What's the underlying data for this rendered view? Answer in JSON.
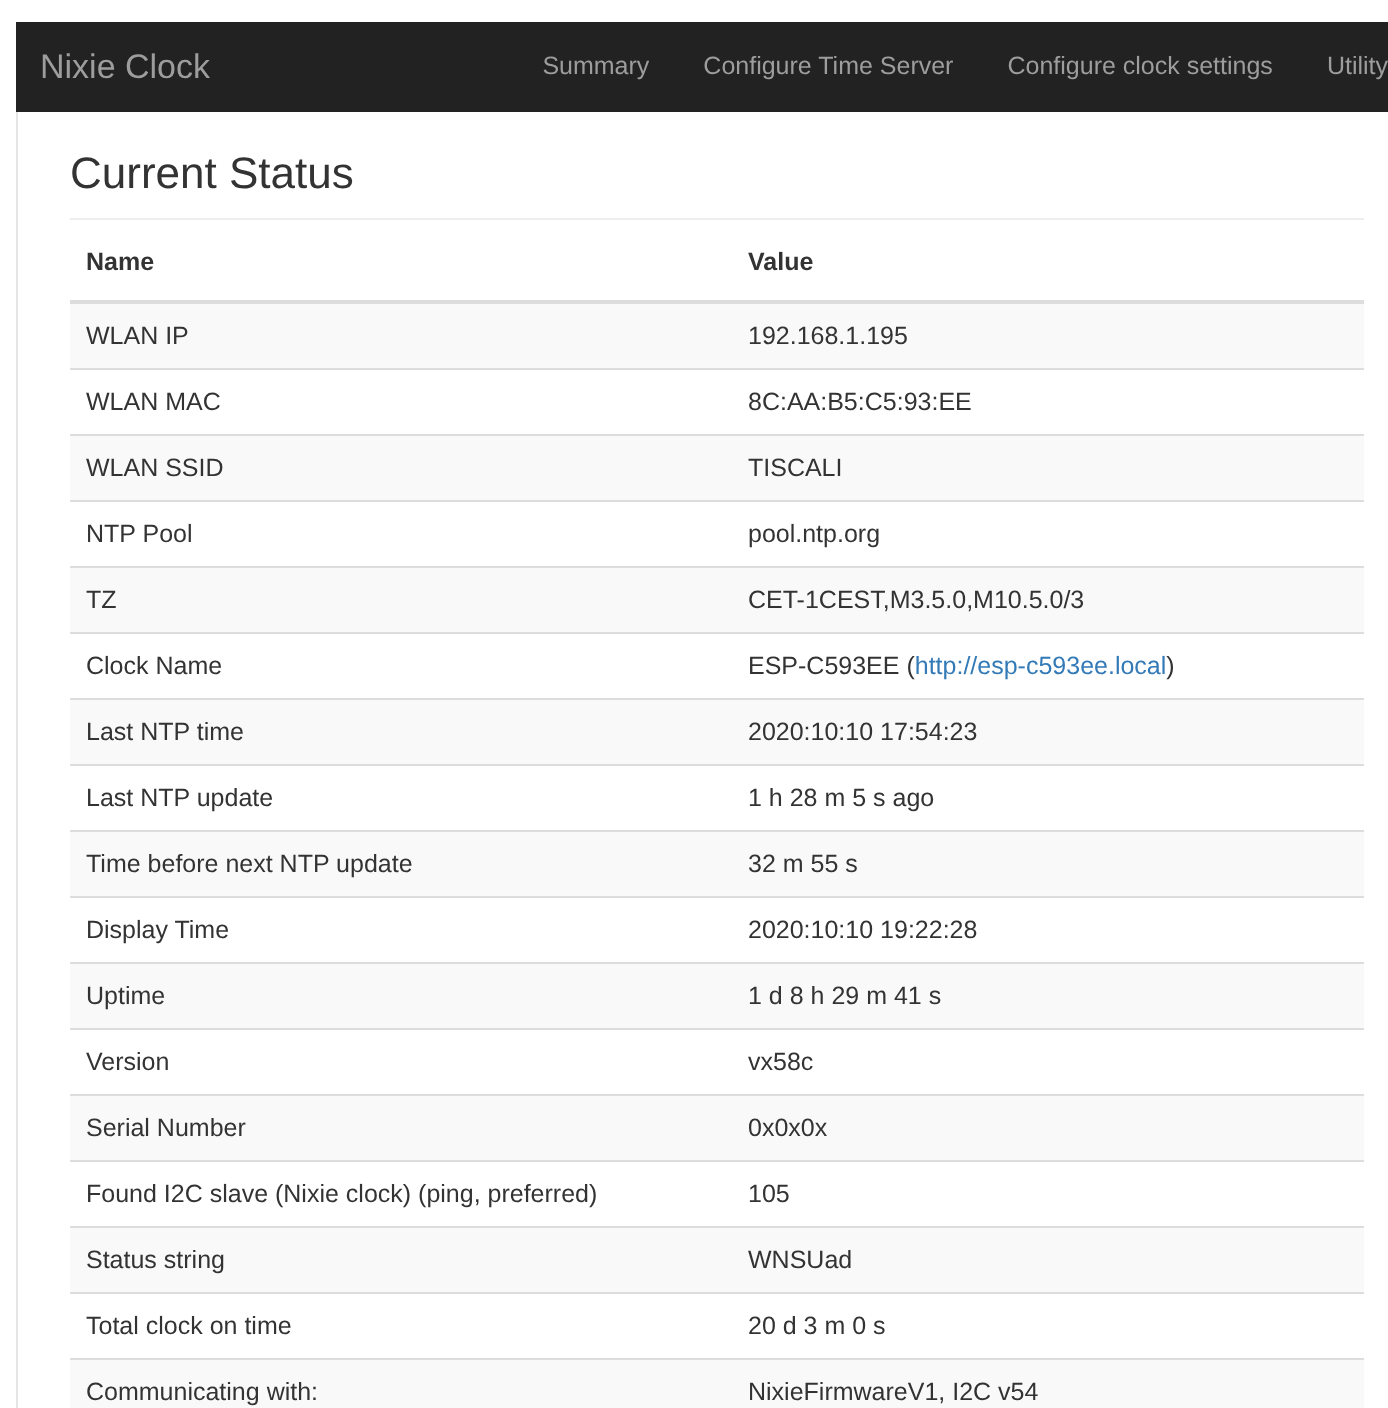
{
  "navbar": {
    "brand": "Nixie Clock",
    "items": [
      "Summary",
      "Configure Time Server",
      "Configure clock settings",
      "Utility"
    ]
  },
  "heading": "Current Status",
  "table": {
    "columns": [
      "Name",
      "Value"
    ],
    "rows": [
      {
        "name": "WLAN IP",
        "value": "192.168.1.195"
      },
      {
        "name": "WLAN MAC",
        "value": "8C:AA:B5:C5:93:EE"
      },
      {
        "name": "WLAN SSID",
        "value": "TISCALI"
      },
      {
        "name": "NTP Pool",
        "value": "pool.ntp.org"
      },
      {
        "name": "TZ",
        "value": "CET-1CEST,M3.5.0,M10.5.0/3"
      },
      {
        "name": "Clock Name",
        "value": "ESP-C593EE (",
        "link": "http://esp-c593ee.local",
        "suffix": ")"
      },
      {
        "name": "Last NTP time",
        "value": "2020:10:10 17:54:23"
      },
      {
        "name": "Last NTP update",
        "value": "1 h 28 m 5 s ago"
      },
      {
        "name": "Time before next NTP update",
        "value": "32 m 55 s"
      },
      {
        "name": "Display Time",
        "value": "2020:10:10 19:22:28"
      },
      {
        "name": "Uptime",
        "value": "1 d 8 h 29 m 41 s"
      },
      {
        "name": "Version",
        "value": "vx58c"
      },
      {
        "name": "Serial Number",
        "value": "0x0x0x"
      },
      {
        "name": "Found I2C slave (Nixie clock) (ping, preferred)",
        "value": "105"
      },
      {
        "name": "Status string",
        "value": "WNSUad"
      },
      {
        "name": "Total clock on time",
        "value": "20 d 3 m 0 s"
      },
      {
        "name": "Communicating with:",
        "value": "NixieFirmwareV1, I2C v54"
      }
    ]
  }
}
